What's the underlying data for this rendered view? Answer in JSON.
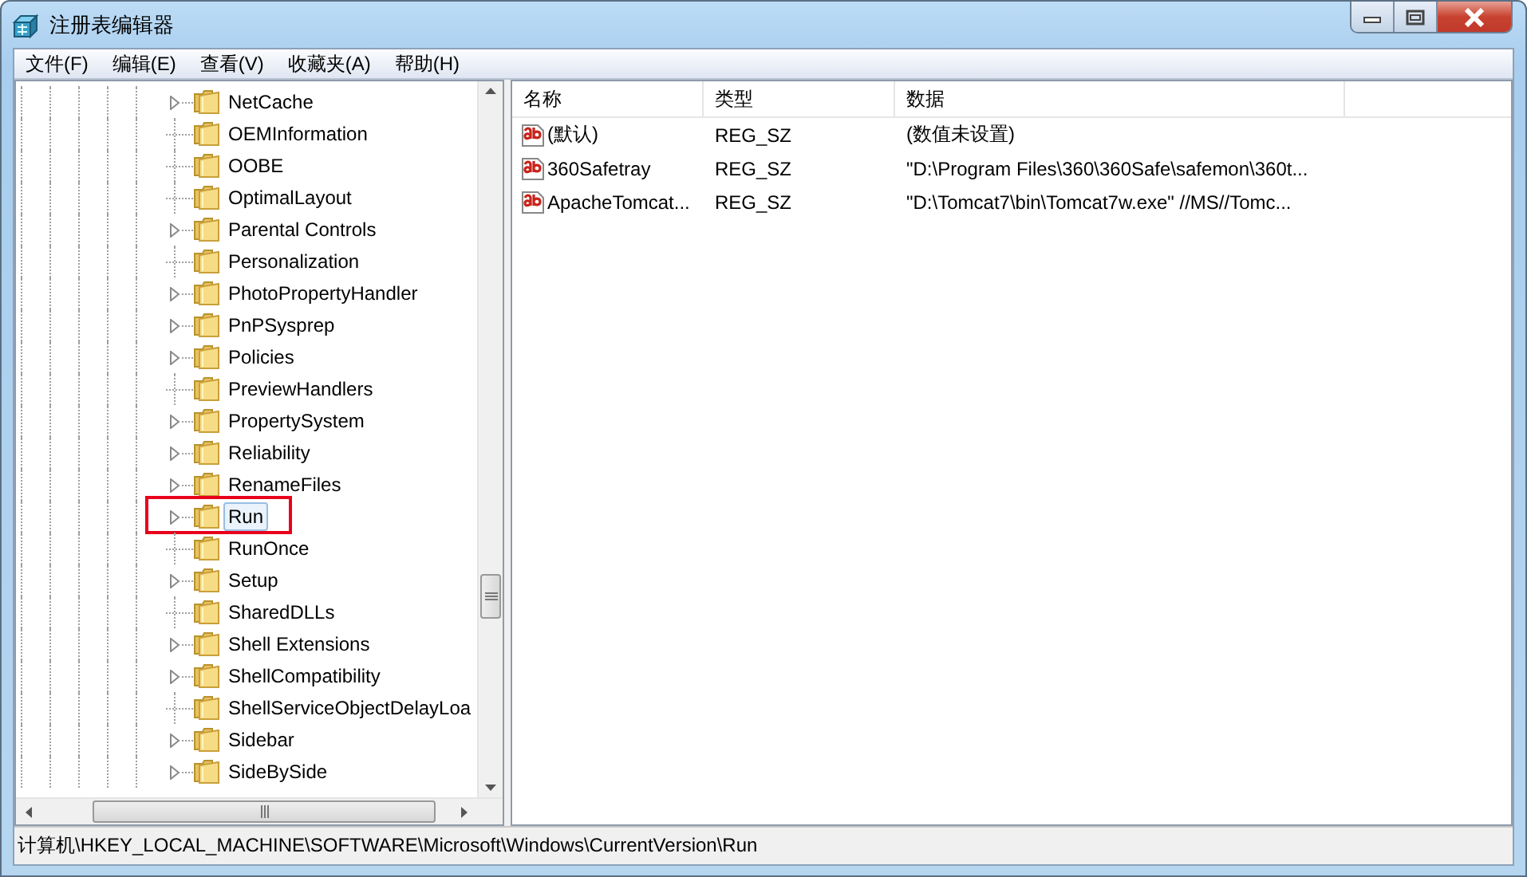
{
  "window": {
    "title": "注册表编辑器"
  },
  "menu": [
    "文件(F)",
    "编辑(E)",
    "查看(V)",
    "收藏夹(A)",
    "帮助(H)"
  ],
  "tree": {
    "items": [
      {
        "label": "NetCache",
        "expandable": true,
        "selected": false,
        "highlighted": false
      },
      {
        "label": "OEMInformation",
        "expandable": false,
        "selected": false,
        "highlighted": false
      },
      {
        "label": "OOBE",
        "expandable": false,
        "selected": false,
        "highlighted": false
      },
      {
        "label": "OptimalLayout",
        "expandable": false,
        "selected": false,
        "highlighted": false
      },
      {
        "label": "Parental Controls",
        "expandable": true,
        "selected": false,
        "highlighted": false
      },
      {
        "label": "Personalization",
        "expandable": false,
        "selected": false,
        "highlighted": false
      },
      {
        "label": "PhotoPropertyHandler",
        "expandable": true,
        "selected": false,
        "highlighted": false
      },
      {
        "label": "PnPSysprep",
        "expandable": true,
        "selected": false,
        "highlighted": false
      },
      {
        "label": "Policies",
        "expandable": true,
        "selected": false,
        "highlighted": false
      },
      {
        "label": "PreviewHandlers",
        "expandable": false,
        "selected": false,
        "highlighted": false
      },
      {
        "label": "PropertySystem",
        "expandable": true,
        "selected": false,
        "highlighted": false
      },
      {
        "label": "Reliability",
        "expandable": true,
        "selected": false,
        "highlighted": false
      },
      {
        "label": "RenameFiles",
        "expandable": true,
        "selected": false,
        "highlighted": false
      },
      {
        "label": "Run",
        "expandable": true,
        "selected": true,
        "highlighted": true
      },
      {
        "label": "RunOnce",
        "expandable": false,
        "selected": false,
        "highlighted": false
      },
      {
        "label": "Setup",
        "expandable": true,
        "selected": false,
        "highlighted": false
      },
      {
        "label": "SharedDLLs",
        "expandable": false,
        "selected": false,
        "highlighted": false
      },
      {
        "label": "Shell Extensions",
        "expandable": true,
        "selected": false,
        "highlighted": false
      },
      {
        "label": "ShellCompatibility",
        "expandable": true,
        "selected": false,
        "highlighted": false
      },
      {
        "label": "ShellServiceObjectDelayLoa",
        "expandable": false,
        "selected": false,
        "highlighted": false
      },
      {
        "label": "Sidebar",
        "expandable": true,
        "selected": false,
        "highlighted": false
      },
      {
        "label": "SideBySide",
        "expandable": true,
        "selected": false,
        "highlighted": false
      }
    ]
  },
  "table": {
    "columns": [
      "名称",
      "类型",
      "数据"
    ],
    "rows": [
      {
        "name": "(默认)",
        "type": "REG_SZ",
        "data": "(数值未设置)"
      },
      {
        "name": "360Safetray",
        "type": "REG_SZ",
        "data": "\"D:\\Program Files\\360\\360Safe\\safemon\\360t..."
      },
      {
        "name": "ApacheTomcat...",
        "type": "REG_SZ",
        "data": "\"D:\\Tomcat7\\bin\\Tomcat7w.exe\" //MS//Tomc..."
      }
    ]
  },
  "status_bar": "计算机\\HKEY_LOCAL_MACHINE\\SOFTWARE\\Microsoft\\Windows\\CurrentVersion\\Run"
}
